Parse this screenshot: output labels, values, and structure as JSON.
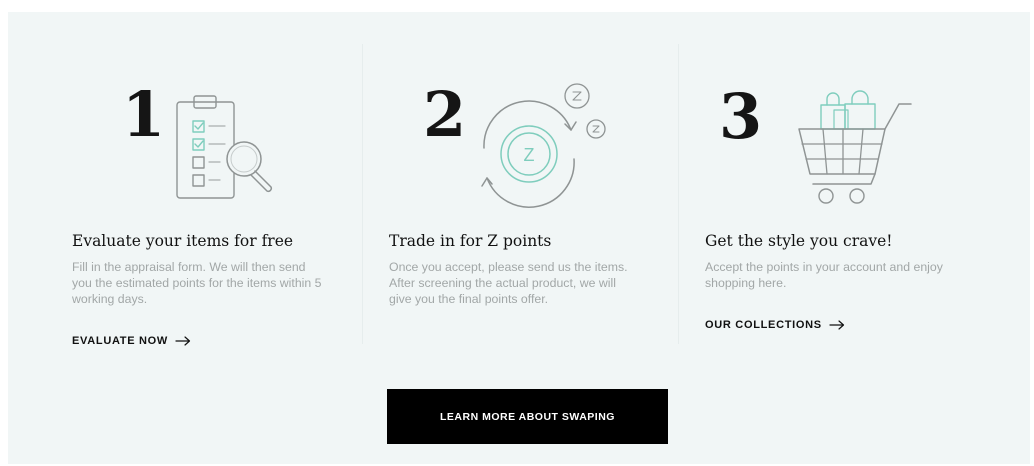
{
  "steps": [
    {
      "number": "1",
      "title": "Evaluate your items for free",
      "description": "Fill in the appraisal form. We will then send you the estimated points for the items within 5 working days.",
      "link_label": "EVALUATE NOW",
      "icon": "clipboard-checklist-magnifier-icon"
    },
    {
      "number": "2",
      "title": "Trade in for Z points",
      "description": "Once you accept, please send us the items. After screening the actual product, we will give you the final points offer.",
      "link_label": "",
      "icon": "z-points-exchange-icon",
      "coin_label": "Z"
    },
    {
      "number": "3",
      "title": "Get the style you crave!",
      "description": "Accept the points in your account and enjoy shopping here.",
      "link_label": "OUR COLLECTIONS",
      "icon": "shopping-cart-bags-icon"
    }
  ],
  "cta": {
    "label": "LEARN MORE ABOUT SWAPING"
  },
  "colors": {
    "panel_bg": "#f1f6f6",
    "accent": "#7fcdbd",
    "icon_stroke": "#8f9494",
    "description": "#a2a7a7",
    "button_bg": "#000000"
  }
}
